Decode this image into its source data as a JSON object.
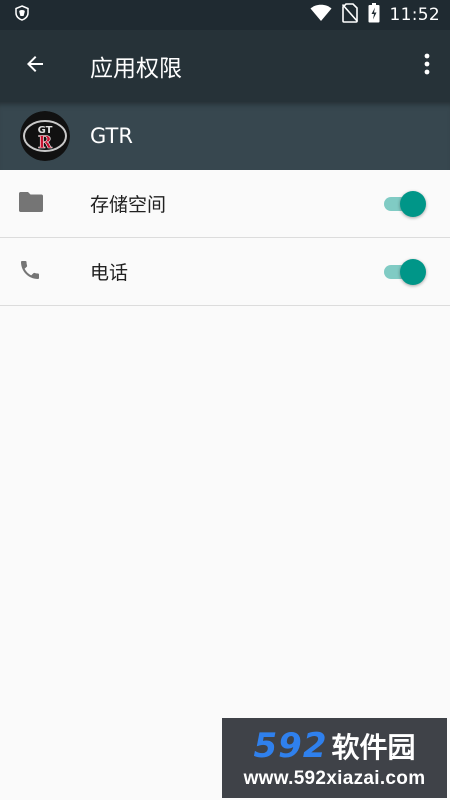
{
  "status_bar": {
    "time": "11:52",
    "icons": [
      "shield-icon",
      "wifi-icon",
      "no-sim-icon",
      "battery-charging-icon"
    ]
  },
  "toolbar": {
    "title": "应用权限",
    "back_icon": "arrow-left-icon",
    "menu_icon": "more-vert-icon"
  },
  "app": {
    "name": "GTR",
    "icon_text": "GT-R"
  },
  "permissions": [
    {
      "label": "存储空间",
      "icon": "folder-icon",
      "enabled": true
    },
    {
      "label": "电话",
      "icon": "phone-icon",
      "enabled": true
    }
  ],
  "colors": {
    "status_bar": "#1f2a31",
    "toolbar": "#263238",
    "app_header": "#37474f",
    "switch_on": "#009688",
    "switch_track": "#80cbc4",
    "background": "#fafafa"
  },
  "watermark": {
    "number": "592",
    "brand": "软件园",
    "url": "www.592xiazai.com"
  }
}
